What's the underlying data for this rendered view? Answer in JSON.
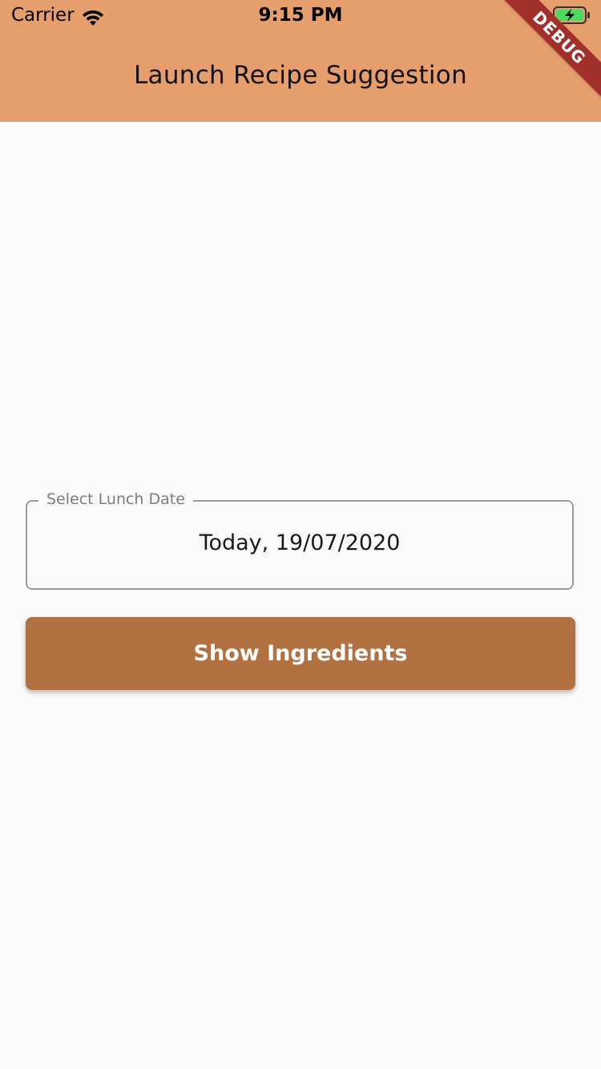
{
  "status_bar": {
    "carrier": "Carrier",
    "time": "9:15 PM",
    "wifi_icon": "wifi-icon",
    "battery_icon": "battery-charging-icon"
  },
  "app_bar": {
    "title": "Launch Recipe Suggestion",
    "background_color": "#e69f6c"
  },
  "debug_banner": {
    "label": "DEBUG",
    "color": "#a2302a"
  },
  "date_field": {
    "label": "Select Lunch Date",
    "value": "Today, 19/07/2020"
  },
  "show_button": {
    "label": "Show Ingredients",
    "color": "#b27140"
  }
}
